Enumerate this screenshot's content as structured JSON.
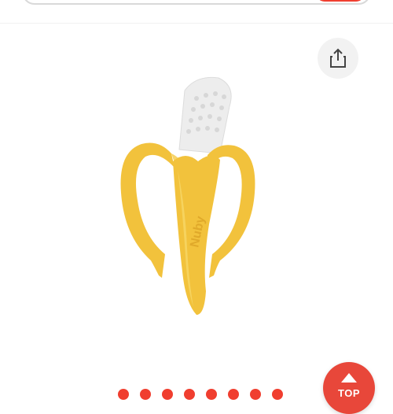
{
  "header": {
    "search_value": ""
  },
  "product": {
    "brand_imprint": "Nuby",
    "image_name": "banana-teether-toothbrush"
  },
  "actions": {
    "share_icon": "share-icon",
    "top_label": "TOP"
  },
  "carousel": {
    "dot_count": 8
  },
  "colors": {
    "accent": "#f03e2f",
    "banana_yellow": "#f2c23c",
    "bristles": "#eeeeee"
  }
}
